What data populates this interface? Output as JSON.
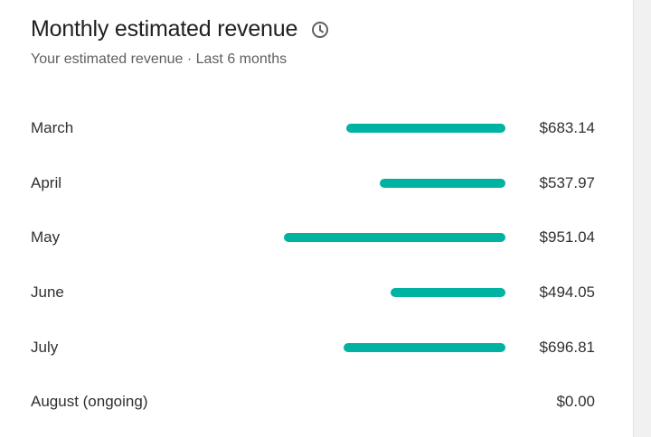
{
  "card": {
    "title": "Monthly estimated revenue",
    "subtitle": "Your estimated revenue · Last 6 months",
    "info_icon": "clock-icon"
  },
  "colors": {
    "bar": "#00b2a2",
    "title": "#202020",
    "subtitle": "#606060"
  },
  "rows": [
    {
      "month": "March",
      "amount": "$683.14",
      "value": 683.14
    },
    {
      "month": "April",
      "amount": "$537.97",
      "value": 537.97
    },
    {
      "month": "May",
      "amount": "$951.04",
      "value": 951.04
    },
    {
      "month": "June",
      "amount": "$494.05",
      "value": 494.05
    },
    {
      "month": "July",
      "amount": "$696.81",
      "value": 696.81
    },
    {
      "month": "August (ongoing)",
      "amount": "$0.00",
      "value": 0
    }
  ]
}
